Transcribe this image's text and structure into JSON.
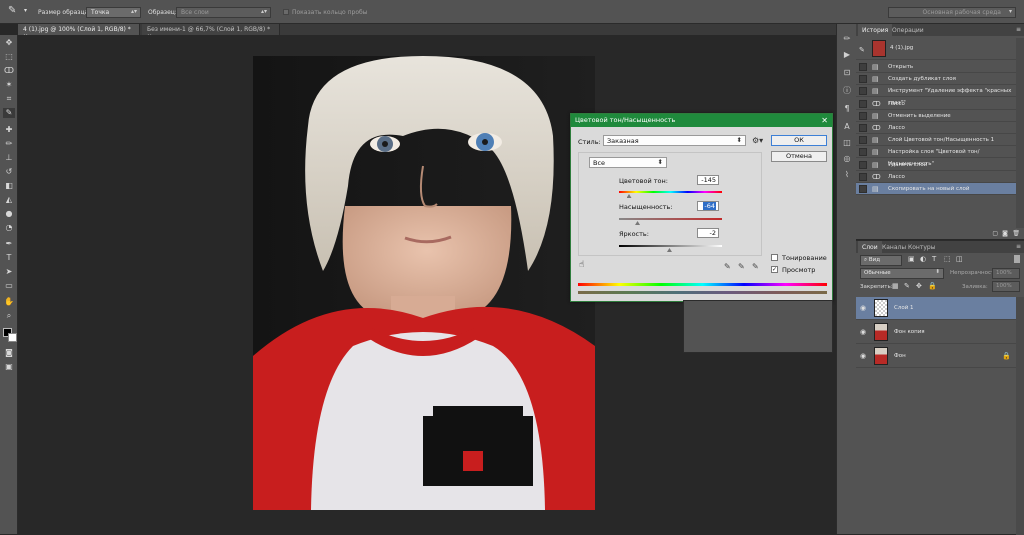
{
  "options_bar": {
    "sample_size_label": "Размер образца:",
    "sample_size_value": "Точка",
    "sample_label": "Образец:",
    "sample_value": "Все слои",
    "show_ring_label": "Показать кольцо пробы",
    "workspace_value": "Основная рабочая среда"
  },
  "tabs": [
    {
      "label": "4 (1).jpg @ 100% (Слой 1, RGB/8) *"
    },
    {
      "label": "Без имени-1 @ 66,7% (Слой 1, RGB/8) *"
    }
  ],
  "history": {
    "tab_history": "История",
    "tab_actions": "Операции",
    "snapshot": "4 (1).jpg",
    "items": [
      {
        "label": "Открыть",
        "icon": "document-icon"
      },
      {
        "label": "Создать дубликат слоя",
        "icon": "document-icon"
      },
      {
        "label": "Инструмент \"Удаление эффекта \"красных глаз\"\"",
        "icon": "document-icon"
      },
      {
        "label": "Лассо",
        "icon": "lasso-icon"
      },
      {
        "label": "Отменить выделение",
        "icon": "document-icon"
      },
      {
        "label": "Лассо",
        "icon": "lasso-icon"
      },
      {
        "label": "Слой Цветовой тон/Насыщенность 1",
        "icon": "document-icon"
      },
      {
        "label": "Настройка слоя \"Цветовой тон/Насыщенность\"",
        "icon": "document-icon"
      },
      {
        "label": "Удалить слой",
        "icon": "document-icon"
      },
      {
        "label": "Лассо",
        "icon": "lasso-icon"
      },
      {
        "label": "Скопировать на новый слой",
        "icon": "document-icon"
      }
    ]
  },
  "layers_panel": {
    "tab_layers": "Слои",
    "tab_channels": "Каналы",
    "tab_paths": "Контуры",
    "filter_kind": "Вид",
    "blend_mode": "Обычные",
    "opacity_label": "Непрозрачность:",
    "opacity_value": "100%",
    "lock_label": "Закрепить:",
    "fill_label": "Заливка:",
    "fill_value": "100%",
    "layers": [
      {
        "name": "Слой 1"
      },
      {
        "name": "Фон копия"
      },
      {
        "name": "Фон"
      }
    ]
  },
  "dialog": {
    "title": "Цветовой тон/Насыщенность",
    "style_label": "Стиль:",
    "style_value": "Заказная",
    "ok_label": "ОК",
    "cancel_label": "Отмена",
    "channel_value": "Все",
    "hue_label": "Цветовой тон:",
    "hue_value": "-145",
    "saturation_label": "Насыщенность:",
    "saturation_value": "-64",
    "lightness_label": "Яркость:",
    "lightness_value": "-2",
    "colorize_label": "Тонирование",
    "preview_label": "Просмотр",
    "colorize_checked": false,
    "preview_checked": true
  }
}
